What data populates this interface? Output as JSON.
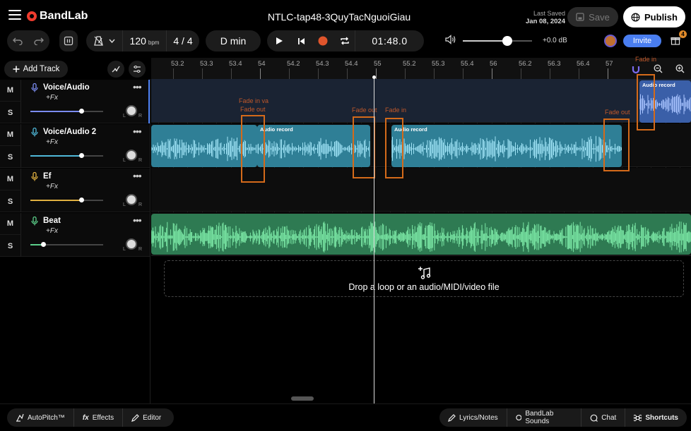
{
  "app": {
    "brand": "BandLab"
  },
  "header": {
    "project_title": "NTLC-tap48-3QuyTacNguoiGiau",
    "last_saved_label": "Last Saved",
    "last_saved_date": "Jan 08, 2024",
    "save_label": "Save",
    "publish_label": "Publish"
  },
  "transport": {
    "tempo": "120",
    "tempo_unit": "bpm",
    "time_signature": "4 / 4",
    "key": "D min",
    "time": "01:48.0",
    "master_gain": "+0.0 dB",
    "master_volume": 0.64,
    "invite_label": "Invite",
    "gift_badge": "4"
  },
  "toolbar": {
    "add_track_label": "Add Track"
  },
  "ruler": {
    "labels": [
      "53.2",
      "53.3",
      "53.4",
      "54",
      "54.2",
      "54.3",
      "54.4",
      "55",
      "55.2",
      "55.3",
      "55.4",
      "56",
      "56.2",
      "56.3",
      "56.4",
      "57"
    ]
  },
  "tracks": [
    {
      "name": "Voice/Audio",
      "fx": "+Fx",
      "volume": 0.71,
      "mute": "M",
      "solo": "S",
      "color": "#7b8cf0",
      "icon": "mic-icon"
    },
    {
      "name": "Voice/Audio 2",
      "fx": "+Fx",
      "volume": 0.71,
      "mute": "M",
      "solo": "S",
      "color": "#4fb8d8",
      "icon": "mic-icon"
    },
    {
      "name": "Ef",
      "fx": "+Fx",
      "volume": 0.71,
      "mute": "M",
      "solo": "S",
      "color": "#e0b040",
      "icon": "mic-icon"
    },
    {
      "name": "Beat",
      "fx": "+Fx",
      "volume": 0.15,
      "mute": "M",
      "solo": "S",
      "color": "#5ccf8a",
      "icon": "mic-icon"
    }
  ],
  "clips": {
    "audio_record_1": "Audio record",
    "audio_record_2": "Audio record",
    "audio_record_3": "Audio record"
  },
  "annotations": {
    "fade_in_va": "Fade in va",
    "fade_out_1": "Fade out",
    "fade_out_2": "Fade out",
    "fade_in_1": "Fade in",
    "fade_out_3": "Fade out",
    "fade_in_top": "Fade in"
  },
  "drop_zone": {
    "text": "Drop a loop or an audio/MIDI/video file"
  },
  "bottom_bar": {
    "autopitch": "AutoPitch™",
    "effects": "Effects",
    "editor": "Editor",
    "lyrics": "Lyrics/Notes",
    "sounds": "BandLab Sounds",
    "chat": "Chat",
    "shortcuts": "Shortcuts"
  },
  "colors": {
    "accent_blue": "#4a7ef0",
    "record_red": "#e0552c",
    "voice2_clip": "#4fb8d8",
    "beat_clip": "#5ccf8a",
    "annotation_orange": "#d46a1a"
  }
}
